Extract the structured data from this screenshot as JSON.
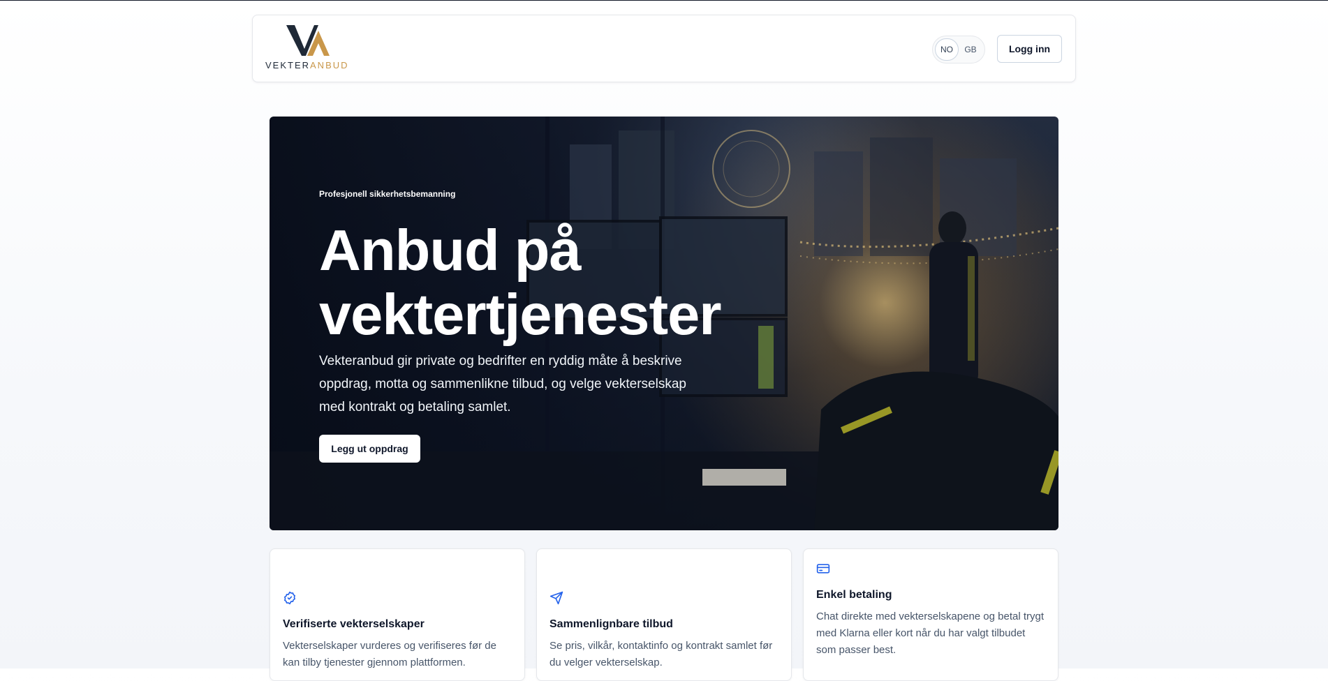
{
  "brand": {
    "logo_text_left": "VEKTER",
    "logo_text_right": "ANBUD",
    "navy": "#1f2937",
    "gold": "#c9974a"
  },
  "header": {
    "languages": [
      {
        "label": "NO",
        "active": true
      },
      {
        "label": "GB",
        "active": false
      }
    ],
    "login_label": "Logg inn"
  },
  "hero": {
    "eyebrow": "Profesjonell sikkerhetsbemanning",
    "title": "Anbud på vektertjenester",
    "text": "Vekteranbud gir private og bedrifter en ryddig måte å beskrive oppdrag, motta og sammenlikne tilbud, og velge vekterselskap med kontrakt og betaling samlet.",
    "cta_label": "Legg ut oppdrag"
  },
  "features": [
    {
      "icon": "badge-check-icon",
      "title": "Verifiserte vekterselskaper",
      "text": "Vekterselskaper vurderes og verifiseres før de kan tilby tjenester gjennom plattformen."
    },
    {
      "icon": "send-icon",
      "title": "Sammenlignbare tilbud",
      "text": "Se pris, vilkår, kontaktinfo og kontrakt samlet før du velger vekterselskap."
    },
    {
      "icon": "credit-card-icon",
      "title": "Enkel betaling",
      "text": "Chat direkte med vekterselskapene og betal trygt med Klarna eller kort når du har valgt tilbudet som passer best."
    }
  ],
  "accent_color": "#2563eb"
}
